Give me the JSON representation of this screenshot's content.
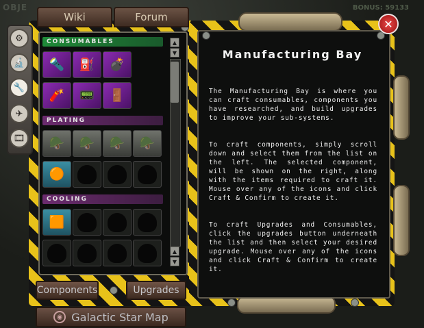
{
  "background": {
    "top_left_text": "OBJE",
    "top_right_text": "BONUS: 59133"
  },
  "top_tabs": {
    "wiki_label": "Wiki",
    "forum_label": "Forum"
  },
  "side_icons": [
    {
      "name": "gears-icon",
      "glyph": "⚙"
    },
    {
      "name": "microscope-icon",
      "glyph": "🔬"
    },
    {
      "name": "wrench-icon",
      "glyph": "🔧"
    },
    {
      "name": "ship-icon",
      "glyph": "✈"
    },
    {
      "name": "film-icon",
      "glyph": "🎞"
    }
  ],
  "sections": {
    "consumables": "CONSUMABLES",
    "plating": "PLATING",
    "cooling": "COOLING"
  },
  "scroll": {
    "up": "▲",
    "down": "▼"
  },
  "bottom_buttons": {
    "components": "Components",
    "upgrades": "Upgrades"
  },
  "star_map": {
    "label": "Galactic Star Map",
    "icon": "◉"
  },
  "close_button": "✕",
  "info": {
    "title": "Manufacturing Bay",
    "paragraph1": "The Manufacturing Bay is where you can craft consumables, components you have researched, and build upgrades to improve your sub-systems.",
    "paragraph2": "To craft components, simply scroll down and select them from the list on the left. The selected component, will be shown on the right, along with the items required to craft it. Mouse over any of the icons and click Craft & Confirm to create it.",
    "paragraph3": "To craft Upgrades and Consumables, click the upgrades button underneath the list and then select your desired upgrade. Mouse over any of the icons and click Craft & Confirm to create it."
  }
}
